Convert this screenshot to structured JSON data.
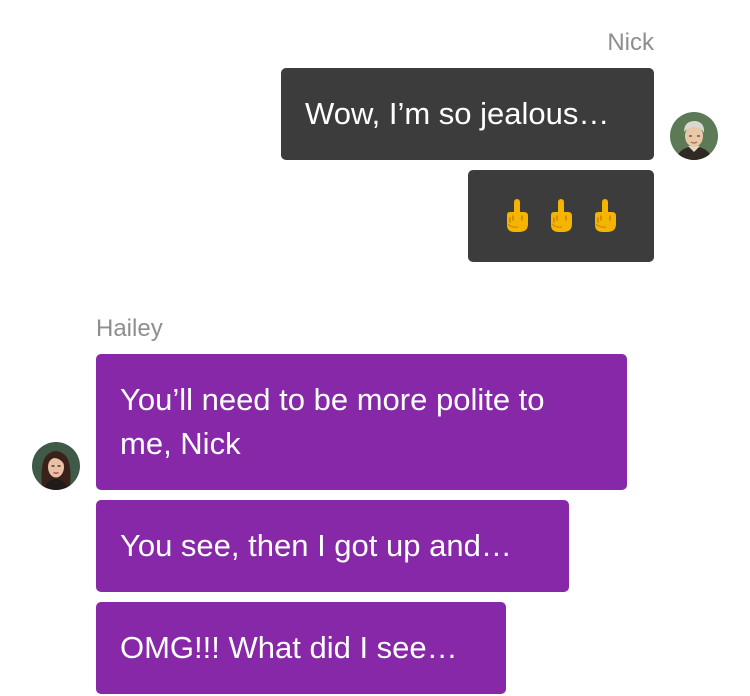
{
  "conversation": {
    "nick": {
      "name": "Nick",
      "avatar": "nick-avatar",
      "messages": [
        {
          "text": "Wow, I’m so jealous…"
        },
        {
          "emoji": [
            "🖕",
            "🖕",
            "🖕"
          ],
          "icons": [
            "middle-finger-icon",
            "middle-finger-icon",
            "middle-finger-icon"
          ]
        }
      ]
    },
    "hailey": {
      "name": "Hailey",
      "avatar": "hailey-avatar",
      "messages": [
        {
          "text": "You’ll need to be more polite to me, Nick"
        },
        {
          "text": "You see, then I got up and…"
        },
        {
          "text": "OMG!!! What did I see…"
        }
      ]
    }
  },
  "colors": {
    "outgoing_bubble": "#3c3c3c",
    "incoming_bubble": "#8628a8",
    "name_text": "#8e8e8e",
    "message_text": "#ffffff"
  }
}
